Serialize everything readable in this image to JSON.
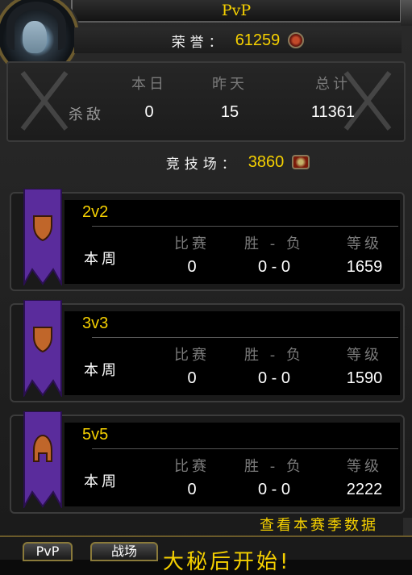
{
  "window": {
    "title": "PvP"
  },
  "honor": {
    "label": "荣誉：",
    "value": "61259",
    "icon": "honor-coin-icon"
  },
  "kills": {
    "headers": [
      "本日",
      "昨天",
      "总计"
    ],
    "row_label": "杀敌",
    "values": [
      "0",
      "15",
      "11361"
    ]
  },
  "arena": {
    "label": "竞技场：",
    "value": "3860",
    "icon": "arena-points-icon"
  },
  "teams": [
    {
      "name": "2v2",
      "week_label": "本周",
      "headers": [
        "比赛",
        "胜 - 负",
        "等级"
      ],
      "values": [
        "0",
        "0 - 0",
        "1659"
      ]
    },
    {
      "name": "3v3",
      "week_label": "本周",
      "headers": [
        "比赛",
        "胜 - 负",
        "等级"
      ],
      "values": [
        "0",
        "0 - 0",
        "1590"
      ]
    },
    {
      "name": "5v5",
      "week_label": "本周",
      "headers": [
        "比赛",
        "胜 - 负",
        "等级"
      ],
      "values": [
        "0",
        "0 - 0",
        "2222"
      ]
    }
  ],
  "season_link": "查看本赛季数据",
  "tabs": [
    "PvP",
    "战场"
  ],
  "news": "大秘后开始!",
  "colors": {
    "gold": "#f5d000",
    "banner_purple": "#5a2c9c"
  }
}
